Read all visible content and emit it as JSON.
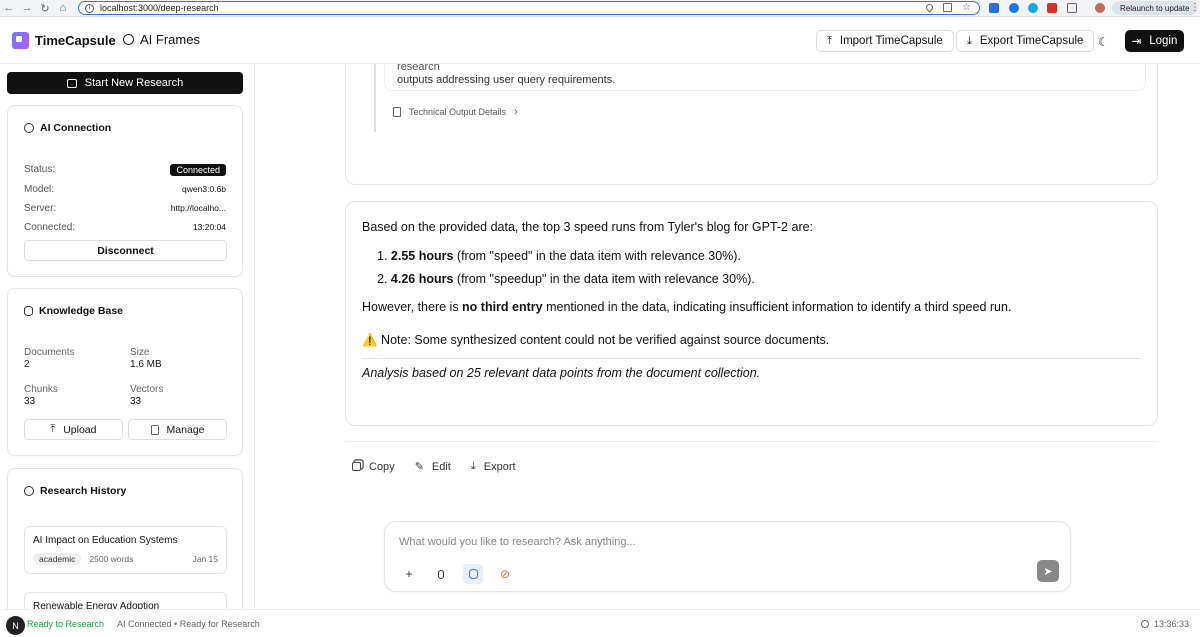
{
  "browser": {
    "url": "localhost:3000/deep-research",
    "relaunch_label": "Relaunch to update"
  },
  "header": {
    "brand": "TimeCapsule",
    "frames_label": "AI Frames",
    "import_label": "Import TimeCapsule",
    "export_label": "Export TimeCapsule",
    "login_label": "Login"
  },
  "sidebar": {
    "new_research_label": "Start New Research",
    "ai_connection": {
      "title": "AI Connection",
      "status_label": "Status:",
      "status_value": "Connected",
      "model_label": "Model:",
      "model_value": "qwen3:0.6b",
      "server_label": "Server:",
      "server_value": "http://localho...",
      "connected_label": "Connected:",
      "connected_value": "13:20:04",
      "disconnect_label": "Disconnect"
    },
    "knowledge_base": {
      "title": "Knowledge Base",
      "documents_label": "Documents",
      "documents_value": "2",
      "size_label": "Size",
      "size_value": "1.6 MB",
      "chunks_label": "Chunks",
      "chunks_value": "33",
      "vectors_label": "Vectors",
      "vectors_value": "33",
      "upload_label": "Upload",
      "manage_label": "Manage"
    },
    "history": {
      "title": "Research History",
      "items": [
        {
          "title": "AI Impact on Education Systems",
          "tag": "academic",
          "words": "2500 words",
          "date": "Jan 15"
        },
        {
          "title": "Renewable Energy Adoption"
        }
      ]
    }
  },
  "main": {
    "prev_text_cut": "✅ Completed advanced data synthesis and integration processes: successfully combined extracted information into coherent, comprehensive research",
    "prev_text_line2": "outputs addressing user query requirements.",
    "tech_details_label": "Technical Output Details",
    "answer": {
      "intro": "Based on the provided data, the top 3 speed runs from Tyler's blog for GPT-2 are:",
      "item1_num": "1.",
      "item1_bold": "2.55 hours",
      "item1_rest": " (from \"speed\" in the data item with relevance 30%).",
      "item2_num": "2.",
      "item2_bold": "4.26 hours",
      "item2_rest": " (from \"speedup\" in the data item with relevance 30%).",
      "p2_pre": "However, there is ",
      "p2_bold": "no third entry",
      "p2_post": " mentioned in the data, indicating insufficient information to identify a third speed run.",
      "note": "⚠️ Note: Some synthesized content could not be verified against source documents.",
      "footer": "Analysis based on 25 relevant data points from the document collection."
    },
    "actions": {
      "copy": "Copy",
      "edit": "Edit",
      "export": "Export"
    },
    "composer_placeholder": "What would you like to research? Ask anything..."
  },
  "statusbar": {
    "avatar": "N",
    "ready": "Ready to Research",
    "ai_status": "AI Connected • Ready for Research",
    "time": "13:36:33"
  },
  "colors": {
    "accent": "#3b74d6",
    "ready_green": "#1f9d47",
    "dark": "#111111"
  }
}
